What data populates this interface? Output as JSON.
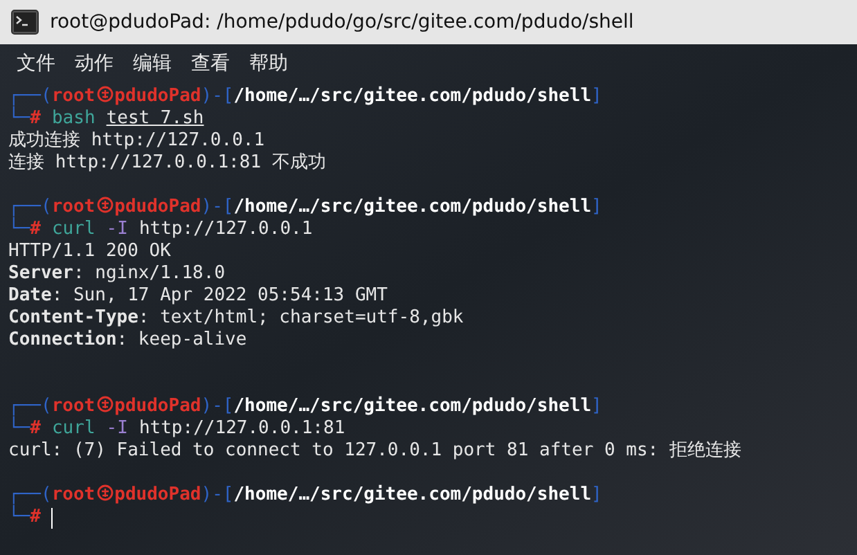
{
  "window": {
    "title": "root@pdudoPad: /home/pdudo/go/src/gitee.com/pdudo/shell"
  },
  "menu": [
    "文件",
    "动作",
    "编辑",
    "查看",
    "帮助"
  ],
  "lines": [
    {
      "kind": "prompt",
      "top": "┌──(",
      "user": "root",
      "host": "pdudoPad",
      "mid": ")-[",
      "path": "/home/…/src/gitee.com/pdudo/shell",
      "end": "]",
      "bottom": "└─",
      "sign": "#",
      "command": "bash",
      "args": [
        {
          "kind": "file",
          "text": "test 7.sh"
        }
      ]
    },
    {
      "kind": "output",
      "text": "成功连接 http://127.0.0.1"
    },
    {
      "kind": "output",
      "text": "连接 http://127.0.0.1:81 不成功"
    },
    {
      "kind": "blank"
    },
    {
      "kind": "prompt",
      "top": "┌──(",
      "user": "root",
      "host": "pdudoPad",
      "mid": ")-[",
      "path": "/home/…/src/gitee.com/pdudo/shell",
      "end": "]",
      "bottom": "└─",
      "sign": "#",
      "command": "curl",
      "args": [
        {
          "kind": "option",
          "text": "-I"
        },
        {
          "kind": "plain",
          "text": "http://127.0.0.1"
        }
      ]
    },
    {
      "kind": "output",
      "text": "HTTP/1.1 200 OK"
    },
    {
      "kind": "output",
      "text": "**Server**: nginx/1.18.0"
    },
    {
      "kind": "output",
      "text": "**Date**: Sun, 17 Apr 2022 05:54:13 GMT"
    },
    {
      "kind": "output",
      "text": "**Content-Type**: text/html; charset=utf-8,gbk"
    },
    {
      "kind": "output",
      "text": "**Connection**: keep-alive"
    },
    {
      "kind": "blank"
    },
    {
      "kind": "blank"
    },
    {
      "kind": "prompt",
      "top": "┌──(",
      "user": "root",
      "host": "pdudoPad",
      "mid": ")-[",
      "path": "/home/…/src/gitee.com/pdudo/shell",
      "end": "]",
      "bottom": "└─",
      "sign": "#",
      "command": "curl",
      "args": [
        {
          "kind": "option",
          "text": "-I"
        },
        {
          "kind": "plain",
          "text": "http://127.0.0.1:81"
        }
      ]
    },
    {
      "kind": "output",
      "text": "curl: (7) Failed to connect to 127.0.0.1 port 81 after 0 ms: 拒绝连接"
    },
    {
      "kind": "blank"
    },
    {
      "kind": "prompt",
      "top": "┌──(",
      "user": "root",
      "host": "pdudoPad",
      "mid": ")-[",
      "path": "/home/…/src/gitee.com/pdudo/shell",
      "end": "]",
      "bottom": "└─",
      "sign": "#",
      "cursor": true
    }
  ]
}
